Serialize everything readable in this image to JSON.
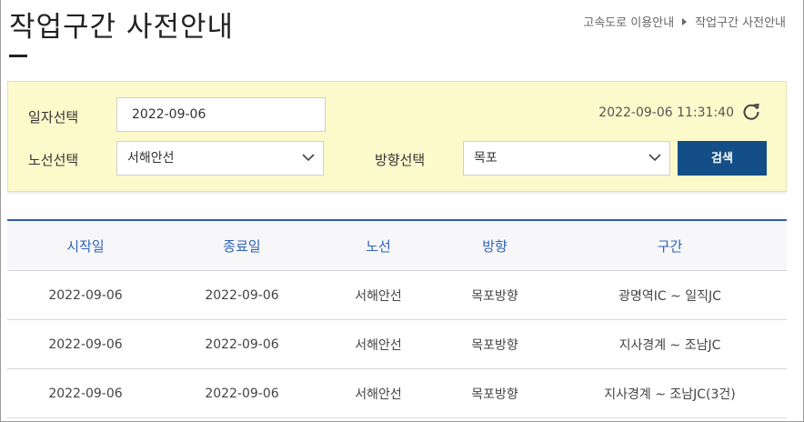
{
  "page": {
    "title": "작업구간 사전안내"
  },
  "breadcrumb": {
    "items": [
      "고속도로 이용안내",
      "작업구간 사전안내"
    ]
  },
  "search": {
    "date_label": "일자선택",
    "date_value": "2022-09-06",
    "route_label": "노선선택",
    "route_value": "서해안선",
    "direction_label": "방향선택",
    "direction_value": "목포",
    "timestamp": "2022-09-06 11:31:40",
    "search_button": "검색"
  },
  "table": {
    "headers": [
      "시작일",
      "종료일",
      "노선",
      "방향",
      "구간"
    ],
    "rows": [
      [
        "2022-09-06",
        "2022-09-06",
        "서해안선",
        "목포방향",
        "광명역IC ~ 일직JC"
      ],
      [
        "2022-09-06",
        "2022-09-06",
        "서해안선",
        "목포방향",
        "지사경계 ~ 조남JC"
      ],
      [
        "2022-09-06",
        "2022-09-06",
        "서해안선",
        "목포방향",
        "지사경계 ~ 조남JC(3건)"
      ]
    ]
  },
  "colors": {
    "accent": "#2e5ea9",
    "button": "#134e86",
    "search_bg": "#fcf9cb"
  }
}
